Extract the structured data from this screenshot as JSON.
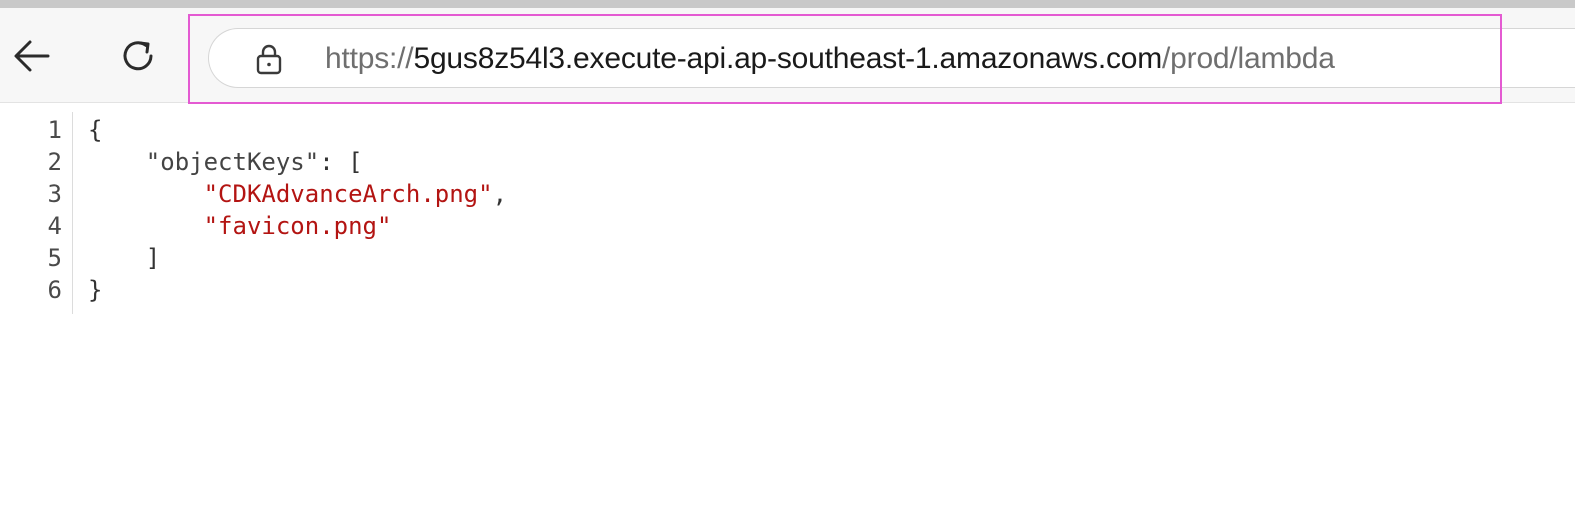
{
  "browser": {
    "url": {
      "scheme": "https://",
      "host": "5gus8z54l3.execute-api.ap-southeast-1.amazonaws.com",
      "path": "/prod/lambda"
    },
    "icons": {
      "back": "arrow-left-icon",
      "reload": "reload-icon",
      "lock": "lock-icon"
    },
    "highlight_color": "#e45ad2"
  },
  "json_viewer": {
    "line_numbers": [
      "1",
      "2",
      "3",
      "4",
      "5",
      "6"
    ],
    "lines": {
      "l1_open": "{",
      "l2_key": "\"objectKeys\"",
      "l2_punct": ": [",
      "l3_value": "\"CDKAdvanceArch.png\"",
      "l3_comma": ",",
      "l4_value": "\"favicon.png\"",
      "l5_close": "]",
      "l6_close": "}"
    },
    "string_color": "#b31412"
  }
}
